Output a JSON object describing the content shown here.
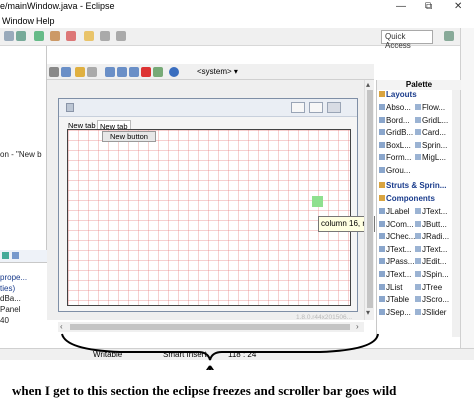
{
  "window": {
    "title": "e/mainWindow.java - Eclipse",
    "minimize_icon": "minimize-icon",
    "maximize_icon": "maximize-icon",
    "close_icon": "close-icon"
  },
  "menubar": {
    "items": [
      "Window",
      "Help"
    ]
  },
  "toolbar": {
    "quick_access": "Quick Access"
  },
  "left_panel": {
    "line1": "on - \"New b",
    "line2": "prope...",
    "line3": "ties)",
    "line4": "dBa...",
    "line5": "Panel",
    "line6": "40"
  },
  "design_toolbar": {
    "system_label": "<system>"
  },
  "design": {
    "tab1": "New tab",
    "tab2": "New tab",
    "button_label": "New button",
    "tooltip": "column 16, r",
    "watermark": "1.8.0.r44x201506..."
  },
  "palette": {
    "title": "Palette",
    "categories": {
      "layouts": "Layouts",
      "struts": "Struts & Sprin...",
      "components": "Components"
    },
    "layout_items": [
      [
        "Abso...",
        "Flow..."
      ],
      [
        "Bord...",
        "GridL..."
      ],
      [
        "GridB...",
        "Card..."
      ],
      [
        "BoxL...",
        "Sprin..."
      ],
      [
        "Form...",
        "MigL..."
      ],
      [
        "Grou...",
        ""
      ]
    ],
    "component_items": [
      [
        "JLabel",
        "JText..."
      ],
      [
        "JCom...",
        "JButt..."
      ],
      [
        "JChec...",
        "JRadi..."
      ],
      [
        "JText...",
        "JText..."
      ],
      [
        "JPass...",
        "JEdit..."
      ],
      [
        "JText...",
        "JSpin..."
      ],
      [
        "JList",
        "JTree"
      ],
      [
        "JTable",
        "JScro..."
      ],
      [
        "JSep...",
        "JSlider"
      ]
    ]
  },
  "statusbar": {
    "writable": "Writable",
    "insert_mode": "Smart Insert",
    "position": "118 : 24"
  },
  "annotation": {
    "caption": "when I get to this section the eclipse freezes and scroller bar goes wild"
  }
}
